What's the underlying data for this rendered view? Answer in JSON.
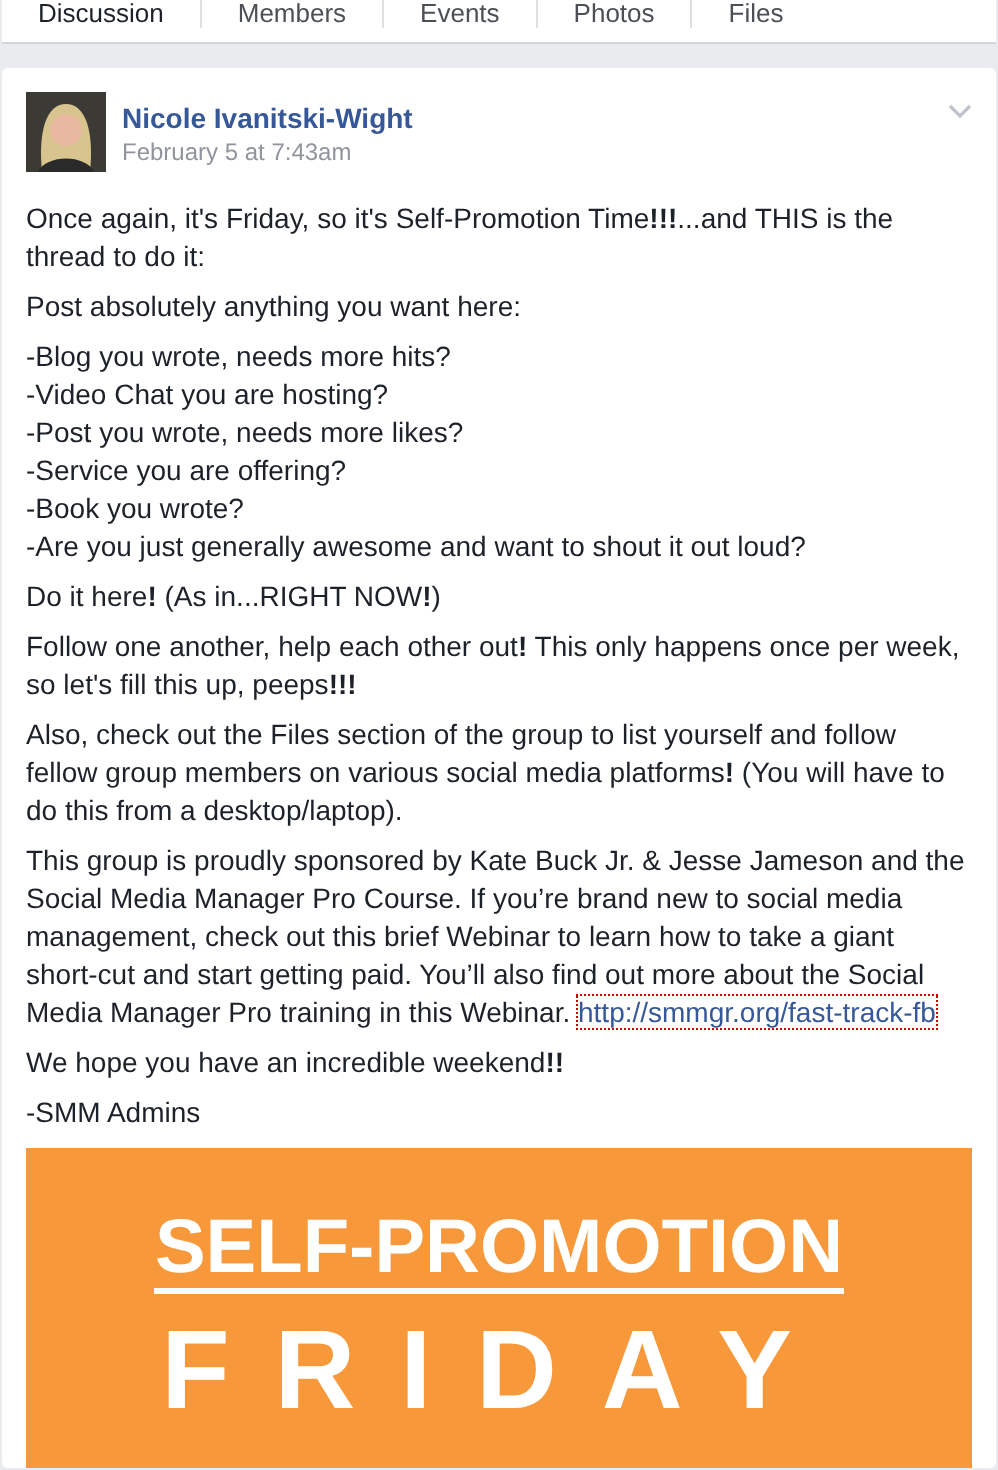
{
  "tabs": [
    {
      "label": "Discussion",
      "selected": true
    },
    {
      "label": "Members",
      "selected": false
    },
    {
      "label": "Events",
      "selected": false
    },
    {
      "label": "Photos",
      "selected": false
    },
    {
      "label": "Files",
      "selected": false
    }
  ],
  "post": {
    "author": "Nicole Ivanitski-Wight",
    "timestamp": "February 5 at 7:43am",
    "paragraphs": [
      {
        "lines": [
          "Once again, it's Friday, so it's Self-Promotion Time**!!!**...and THIS is the thread to do it:"
        ]
      },
      {
        "lines": [
          "Post absolutely anything you want here:"
        ]
      },
      {
        "lines": [
          "-Blog you wrote, needs more hits?",
          "-Video Chat you are hosting?",
          "-Post you wrote, needs more likes?",
          "-Service you are offering?",
          "-Book you wrote?",
          "-Are you just generally awesome and want to shout it out loud?"
        ]
      },
      {
        "lines": [
          "Do it here**!** (As in...RIGHT NOW**!**)"
        ]
      },
      {
        "lines": [
          "Follow one another, help each other out**!** This only happens once per week, so let's fill this up, peeps**!!!**"
        ]
      },
      {
        "lines": [
          "Also, check out the Files section of the group to list yourself and follow fellow group members on various social media platforms**!** (You will have to do this from a desktop/laptop)."
        ]
      },
      {
        "lines": [
          "This group is proudly sponsored by Kate Buck Jr. & Jesse Jameson and the Social Media Manager Pro Course. If you’re brand new to social media management, check out this brief Webinar to learn how to take a giant short-cut and start getting paid. You’ll also find out more about the Social Media Manager Pro training in this Webinar."
        ],
        "link": "http://smmgr.org/fast-track-fb"
      },
      {
        "lines": [
          "We hope you have an incredible weekend**!!**"
        ]
      },
      {
        "lines": [
          "-SMM Admins"
        ]
      }
    ],
    "image": {
      "headline": "SELF-PROMOTION",
      "subline": "FRIDAY"
    }
  }
}
